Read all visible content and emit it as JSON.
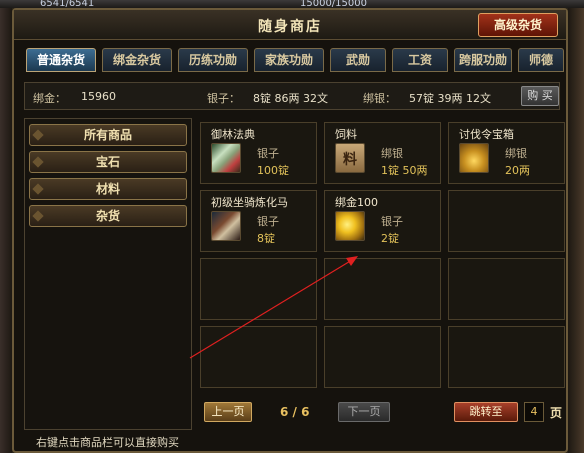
{
  "backdrop": {
    "hp_text": "6541/6541",
    "mp_text": "15000/15000"
  },
  "window": {
    "title": "随身商店",
    "advanced_button": "高级杂货"
  },
  "tabs": [
    {
      "label": "普通杂货",
      "active": true
    },
    {
      "label": "绑金杂货",
      "active": false
    },
    {
      "label": "历练功勋",
      "active": false
    },
    {
      "label": "家族功勋",
      "active": false
    },
    {
      "label": "武勋",
      "active": false
    },
    {
      "label": "工资",
      "active": false
    },
    {
      "label": "跨服功勋",
      "active": false
    },
    {
      "label": "师德",
      "active": false
    }
  ],
  "currency": {
    "bound_gold_label": "绑金：",
    "bound_gold_value": "15960",
    "silver_label": "银子：",
    "silver_value": "8锭 86两 32文",
    "bound_silver_label": "绑银：",
    "bound_silver_value": "57锭 39两 12文",
    "buy_button": "购 买"
  },
  "categories": [
    {
      "label": "所有商品"
    },
    {
      "label": "宝石"
    },
    {
      "label": "材料"
    },
    {
      "label": "杂货"
    }
  ],
  "items": [
    {
      "name": "御林法典",
      "currency": "银子",
      "price": "100锭",
      "icon": "scroll-icon"
    },
    {
      "name": "饲料",
      "currency": "绑银",
      "price": "1锭 50两",
      "icon": "feed-icon",
      "icon_glyph": "料"
    },
    {
      "name": "讨伐令宝箱",
      "currency": "绑银",
      "price": "20两",
      "icon": "treasure-chest-icon"
    },
    {
      "name": "初级坐骑炼化马",
      "currency": "银子",
      "price": "8锭",
      "icon": "horse-icon"
    },
    {
      "name": "绑金100",
      "currency": "银子",
      "price": "2锭",
      "icon": "gold-ingot-icon"
    }
  ],
  "pagination": {
    "prev_button": "上一页",
    "page_indicator": "6 / 6",
    "next_button": "下一页",
    "jump_button": "跳转至",
    "jump_value": "4",
    "page_suffix": "页"
  },
  "hint": "右键点击商品栏可以直接购买",
  "colors": {
    "accent_gold": "#e2c25a",
    "active_tab": "#3d6d92",
    "arrow": "#e02020"
  }
}
